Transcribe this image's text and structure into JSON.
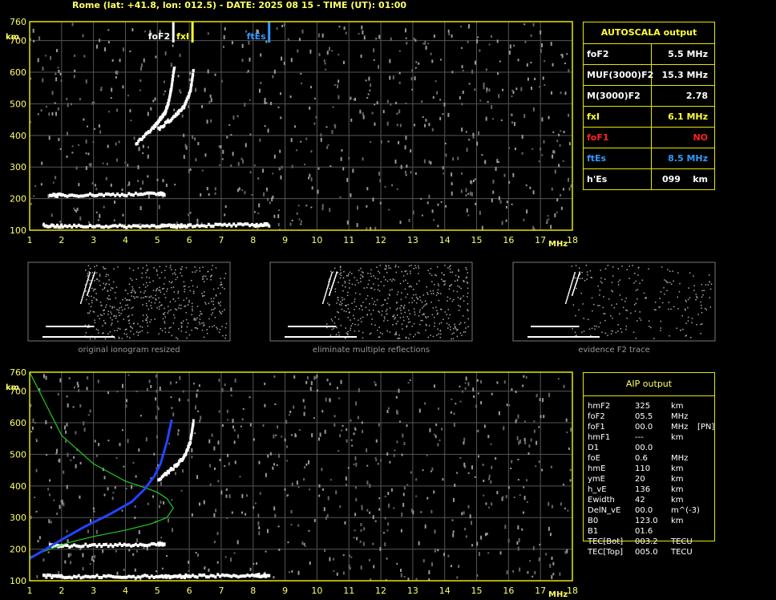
{
  "header": "Rome (lat: +41.8, lon: 012.5) - DATE: 2025 08 15 - TIME (UT): 01:00",
  "colors": {
    "axis_text": "#ffff66",
    "frame": "#e6e600",
    "grid": "#555555",
    "trace": "#ffffff",
    "fof2_marker": "#ffffff",
    "fxi_marker": "#ffff33",
    "ftes_marker": "#3399ff",
    "profile": "#22cc22",
    "true_height": "#2244ff"
  },
  "autoscala": {
    "title": "AUTOSCALA output",
    "rows": [
      {
        "label": "foF2",
        "value": "5.5 MHz",
        "color": "#ffffff"
      },
      {
        "label": "MUF(3000)F2",
        "value": "15.3 MHz",
        "color": "#ffffff"
      },
      {
        "label": "M(3000)F2",
        "value": "2.78",
        "color": "#ffffff"
      },
      {
        "label": "fxI",
        "value": "6.1 MHz",
        "color": "#ffff33"
      },
      {
        "label": "foF1",
        "value": "NO",
        "color": "#ff2222"
      },
      {
        "label": "ftEs",
        "value": "8.5 MHz",
        "color": "#3399ff"
      },
      {
        "label": "h'Es",
        "value": "099    km",
        "color": "#ffffff"
      }
    ]
  },
  "aip": {
    "title": "AIP output",
    "rows": [
      [
        "hmF2",
        "325",
        "km",
        ""
      ],
      [
        "foF2",
        "05.5",
        "MHz",
        ""
      ],
      [
        "foF1",
        "00.0",
        "MHz",
        "[PN]"
      ],
      [
        "hmF1",
        "---",
        "km",
        ""
      ],
      [
        "D1",
        "00.0",
        "",
        ""
      ],
      [
        "foE",
        "0.6",
        "MHz",
        ""
      ],
      [
        "hmE",
        "110",
        "km",
        ""
      ],
      [
        "ymE",
        "20",
        "km",
        ""
      ],
      [
        "h_vE",
        "136",
        "km",
        ""
      ],
      [
        "Ewidth",
        "42",
        "km",
        ""
      ],
      [
        "DelN_vE",
        "00.0",
        "m^(-3)",
        ""
      ],
      [
        "B0",
        "123.0",
        "km",
        ""
      ],
      [
        "B1",
        "01.6",
        "",
        ""
      ],
      [
        "TEC[Bot]",
        "003.2",
        "TECU",
        ""
      ],
      [
        "TEC[Top]",
        "005.0",
        "TECU",
        ""
      ]
    ]
  },
  "panel_captions": [
    "original ionogram resized",
    "eliminate multiple reflections",
    "evidence F2 trace"
  ],
  "chart_data": [
    {
      "type": "scatter",
      "title": "",
      "xlabel": "MHz",
      "ylabel": "km",
      "xlim": [
        1,
        18
      ],
      "ylim": [
        100,
        760
      ],
      "x_ticks": [
        "1",
        "2",
        "3",
        "4",
        "5",
        "6",
        "7",
        "8",
        "9",
        "10",
        "11",
        "12",
        "13",
        "14",
        "15",
        "16",
        "17",
        "18"
      ],
      "y_ticks": [
        "100",
        "200",
        "300",
        "400",
        "500",
        "600",
        "700",
        "760"
      ],
      "grid": true,
      "markers": [
        {
          "name": "foF2",
          "x": 5.5,
          "color": "#ffffff"
        },
        {
          "name": "fxI",
          "x": 6.1,
          "color": "#ffff33"
        },
        {
          "name": "ftEs",
          "x": 8.5,
          "color": "#3399ff"
        }
      ],
      "traces": [
        {
          "name": "Es",
          "x": [
            1.4,
            2,
            3,
            4,
            5,
            5.5,
            6,
            7,
            8,
            8.5
          ],
          "y": [
            115,
            112,
            113,
            112,
            114,
            112,
            115,
            116,
            116,
            117
          ]
        },
        {
          "name": "F-multiple",
          "x": [
            1.6,
            2,
            3,
            4,
            5,
            5.2
          ],
          "y": [
            212,
            210,
            212,
            213,
            215,
            214
          ]
        },
        {
          "name": "F2-o",
          "x": [
            4.3,
            4.8,
            5.0,
            5.2,
            5.3,
            5.4,
            5.5
          ],
          "y": [
            375,
            420,
            445,
            470,
            500,
            550,
            620
          ]
        },
        {
          "name": "F2-x",
          "x": [
            5.0,
            5.5,
            5.8,
            6.0,
            6.1
          ],
          "y": [
            420,
            460,
            490,
            540,
            610
          ]
        }
      ]
    },
    {
      "type": "line",
      "title": "",
      "xlabel": "MHz",
      "ylabel": "km",
      "xlim": [
        1,
        18
      ],
      "ylim": [
        100,
        760
      ],
      "x_ticks": [
        "1",
        "2",
        "3",
        "4",
        "5",
        "6",
        "7",
        "8",
        "9",
        "10",
        "11",
        "12",
        "13",
        "14",
        "15",
        "16",
        "17",
        "18"
      ],
      "y_ticks": [
        "100",
        "200",
        "300",
        "400",
        "500",
        "600",
        "700",
        "760"
      ],
      "grid": true,
      "series": [
        {
          "name": "",
          "color": "#22cc22",
          "x": [
            1.0,
            1.5,
            2.0,
            3.0,
            4.0,
            4.6,
            5.0,
            5.3,
            5.5,
            5.3,
            4.8,
            4.0,
            3.0,
            2.2,
            1.5,
            1.0
          ],
          "y": [
            760,
            660,
            560,
            470,
            415,
            395,
            380,
            360,
            330,
            300,
            280,
            260,
            240,
            220,
            195,
            175
          ]
        },
        {
          "name": "",
          "color": "#2244ff",
          "x": [
            1.0,
            1.5,
            2.0,
            2.7,
            3.5,
            4.2,
            4.6,
            4.9,
            5.1,
            5.3,
            5.45
          ],
          "y": [
            170,
            200,
            230,
            270,
            310,
            350,
            390,
            430,
            470,
            540,
            610
          ]
        }
      ],
      "traces": [
        {
          "name": "Es",
          "x": [
            1.4,
            2,
            3,
            4,
            5,
            5.5,
            6,
            7,
            8,
            8.5
          ],
          "y": [
            115,
            112,
            113,
            112,
            114,
            112,
            115,
            116,
            116,
            117
          ]
        },
        {
          "name": "F-multiple",
          "x": [
            1.6,
            2,
            3,
            4,
            5,
            5.2
          ],
          "y": [
            212,
            210,
            212,
            213,
            215,
            214
          ]
        },
        {
          "name": "F2-x",
          "x": [
            5.0,
            5.5,
            5.8,
            6.0,
            6.1
          ],
          "y": [
            420,
            460,
            490,
            540,
            610
          ]
        }
      ]
    }
  ]
}
